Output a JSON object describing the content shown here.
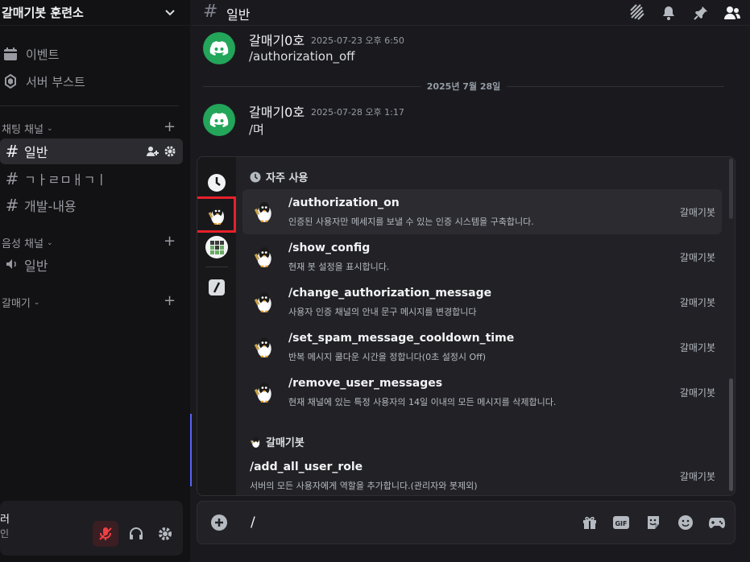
{
  "server": {
    "name": "갈매기봇 훈련소"
  },
  "sidebar": {
    "top_items": [
      {
        "label": "이벤트",
        "icon": "calendar-icon"
      },
      {
        "label": "서버 부스트",
        "icon": "boost-icon"
      }
    ],
    "categories": [
      {
        "label": "채팅 채널",
        "channels": [
          "일반",
          "ㄱㅏㄹㅁㅐㄱㅣ",
          "개발-내용"
        ]
      },
      {
        "label": "음성 채널",
        "channels": [
          "일반"
        ]
      },
      {
        "label": "갈매기",
        "channels": []
      }
    ]
  },
  "user_panel": {
    "name": "러",
    "status": "인"
  },
  "channel": {
    "name": "일반"
  },
  "messages": [
    {
      "author": "갈매기0호",
      "time": "2025-07-23 오후 6:50",
      "text": "/authorization_off"
    },
    {
      "author": "갈매기0호",
      "time": "2025-07-28 오후 1:17",
      "text": "/며"
    }
  ],
  "date_separator": "2025년 7월 28일",
  "command_popup": {
    "frequent_header": "자주 사용",
    "bot_header": "갈매기봇",
    "frequent_commands": [
      {
        "name": "/authorization_on",
        "desc": "인증된 사용자만 메세지를 보낼 수 있는 인증 시스템을 구축합니다.",
        "bot": "갈매기봇"
      },
      {
        "name": "/show_config",
        "desc": "현재 봇 설정을 표시합니다.",
        "bot": "갈매기봇"
      },
      {
        "name": "/change_authorization_message",
        "desc": "사용자 인증 채널의 안내 문구 메시지를 변경합니다",
        "bot": "갈매기봇"
      },
      {
        "name": "/set_spam_message_cooldown_time",
        "desc": "반복 메시지 쿨다운 시간을 정합니다(0초 설정시 Off)",
        "bot": "갈매기봇"
      },
      {
        "name": "/remove_user_messages",
        "desc": "현재 채널에 있는 특정 사용자의 14일 이내의 모든 메시지를 삭제합니다.",
        "bot": "갈매기봇"
      }
    ],
    "bot_commands": [
      {
        "name": "/add_all_user_role",
        "desc": "서버의 모든 사용자에게 역할을 추가합니다.(관리자와 봇제외)",
        "bot": "갈매기봇"
      }
    ]
  },
  "composer": {
    "value": "/",
    "gif_label": "GIF"
  },
  "colors": {
    "accent": "#5865f2",
    "highlight_box": "#e8202a",
    "avatar_green": "#23a55a",
    "muted_red": "#3a1e22"
  }
}
